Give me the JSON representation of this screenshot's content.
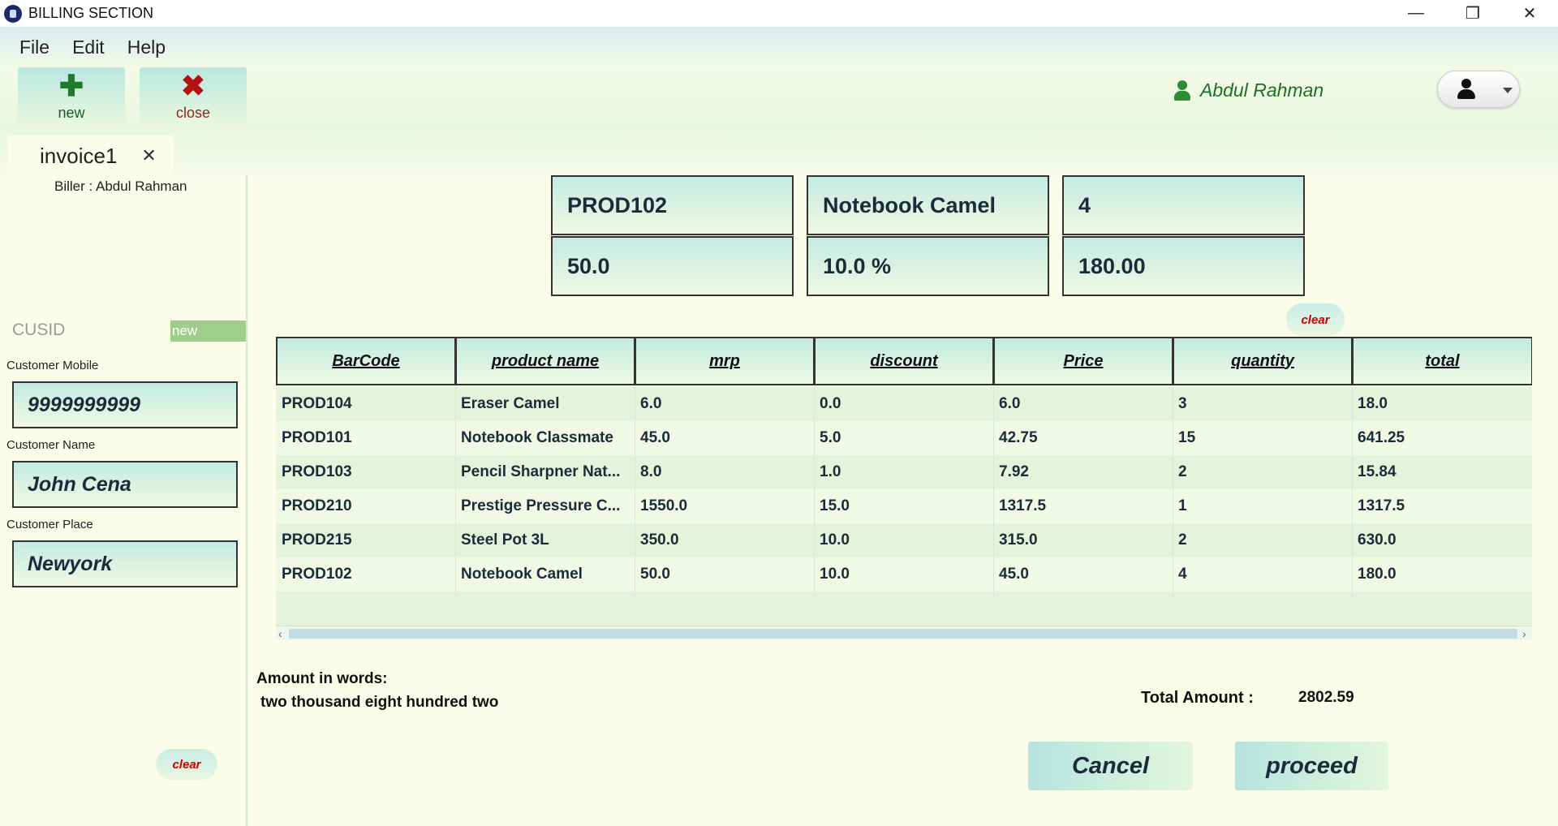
{
  "window": {
    "title": "BILLING SECTION",
    "controls": {
      "minimize": "—",
      "restore": "❐",
      "close": "✕"
    }
  },
  "menu": {
    "items": [
      "File",
      "Edit",
      "Help"
    ]
  },
  "toolbar": {
    "new_label": "new",
    "new_glyph": "✚",
    "close_label": "close",
    "close_glyph": "✖",
    "user_name": "Abdul Rahman"
  },
  "tab": {
    "label": "invoice1",
    "close_glyph": "✕"
  },
  "left": {
    "biller": "Biller :  Abdul Rahman",
    "cusid_label": "CUSID",
    "cusid_value": "new",
    "mobile_label": "Customer Mobile",
    "mobile_value": "9999999999",
    "name_label": "Customer Name",
    "name_value": "John Cena",
    "place_label": "Customer Place",
    "place_value": "Newyork",
    "clear_label": "clear"
  },
  "product": {
    "barcode": "PROD102",
    "name": "Notebook Camel",
    "quantity": "4",
    "mrp": "50.0",
    "discount": "10.0 %",
    "total": "180.00",
    "clear_label": "clear"
  },
  "table": {
    "columns": [
      "BarCode",
      "product name",
      "mrp",
      "discount",
      "Price",
      "quantity",
      "total"
    ],
    "rows": [
      [
        "PROD104",
        "Eraser Camel",
        "6.0",
        "0.0",
        "6.0",
        "3",
        "18.0"
      ],
      [
        "PROD101",
        "Notebook Classmate",
        "45.0",
        "5.0",
        "42.75",
        "15",
        "641.25"
      ],
      [
        "PROD103",
        "Pencil Sharpner Nat...",
        "8.0",
        "1.0",
        "7.92",
        "2",
        "15.84"
      ],
      [
        "PROD210",
        "Prestige Pressure C...",
        "1550.0",
        "15.0",
        "1317.5",
        "1",
        "1317.5"
      ],
      [
        "PROD215",
        "Steel Pot 3L",
        "350.0",
        "10.0",
        "315.0",
        "2",
        "630.0"
      ],
      [
        "PROD102",
        "Notebook Camel",
        "50.0",
        "10.0",
        "45.0",
        "4",
        "180.0"
      ]
    ]
  },
  "footer": {
    "amount_words_label": "Amount in words:",
    "amount_words": "two thousand eight hundred two",
    "total_label": "Total Amount :",
    "total_value": "2802.59",
    "cancel_label": "Cancel",
    "proceed_label": "proceed"
  },
  "colors": {
    "accent_green": "#1d6e2b",
    "clear_red": "#cc0000",
    "field_gradient_top": "#c3ebe3"
  }
}
